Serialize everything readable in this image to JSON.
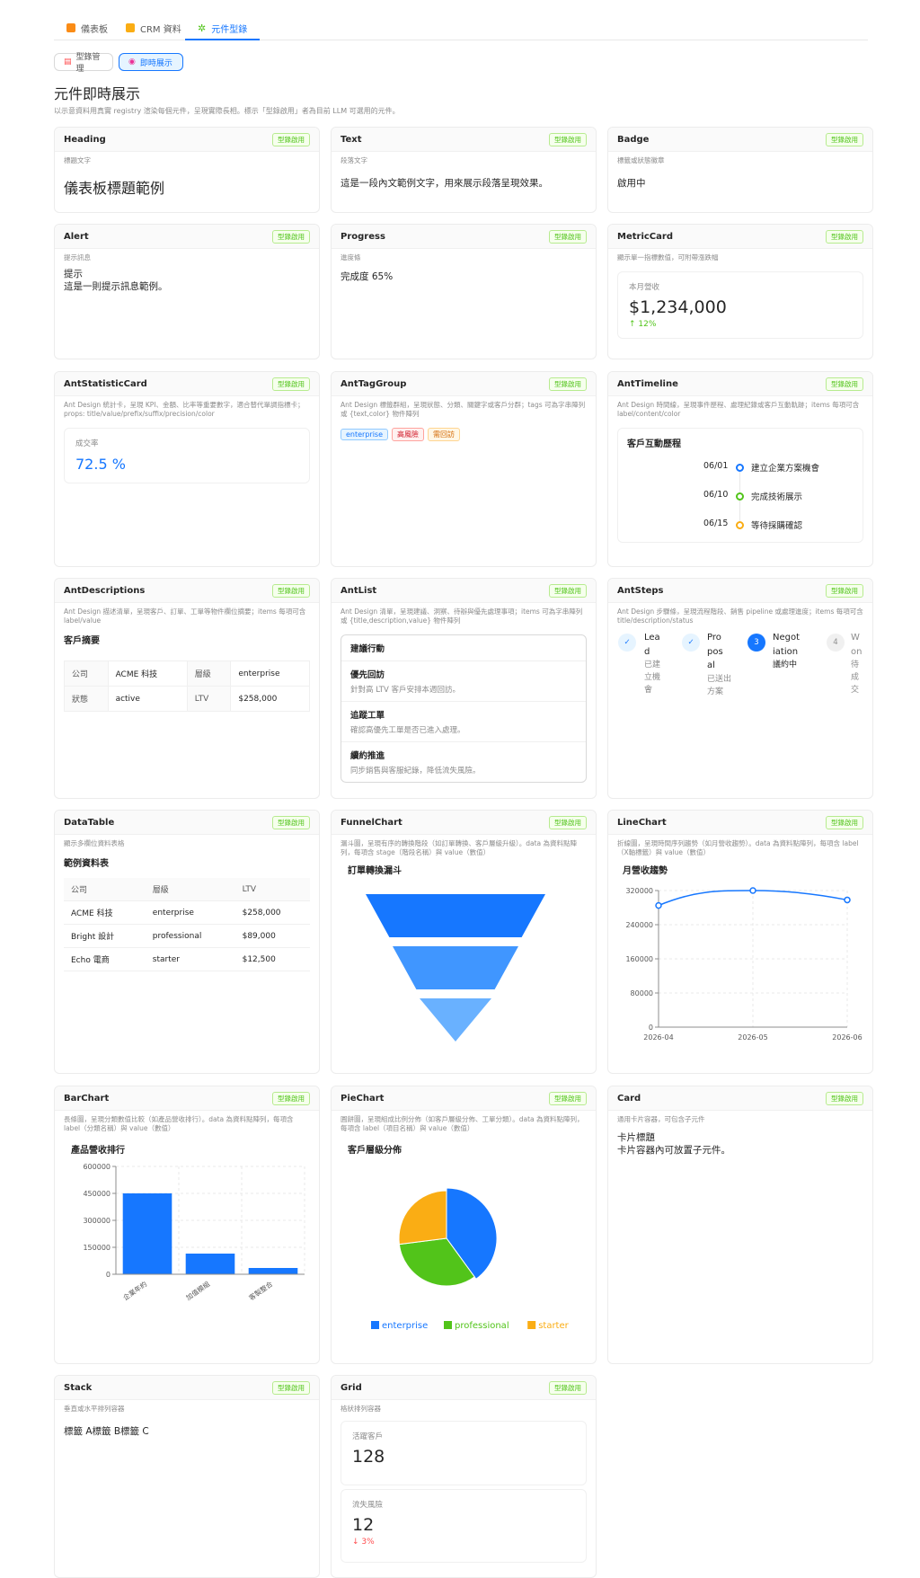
{
  "tabs": [
    {
      "label": "儀表板",
      "color": "#fa8c16"
    },
    {
      "label": "CRM 資料",
      "color": "#faad14"
    },
    {
      "label": "元件型錄",
      "color": "#52c41a"
    }
  ],
  "subtabs": [
    {
      "label": "型錄管理"
    },
    {
      "label": "即時展示"
    }
  ],
  "page": {
    "title": "元件即時展示",
    "description": "以示意資料用真實 registry 渲染每個元件，呈現實際長相。標示「型錄啟用」者為目前 LLM 可選用的元件。"
  },
  "badge_label": "型錄啟用",
  "cards": {
    "heading": {
      "name": "Heading",
      "desc": "標題文字",
      "text": "儀表板標題範例"
    },
    "text": {
      "name": "Text",
      "desc": "段落文字",
      "text": "這是一段內文範例文字，用來展示段落呈現效果。"
    },
    "badge": {
      "name": "Badge",
      "desc": "標籤或狀態徽章",
      "text": "啟用中"
    },
    "alert": {
      "name": "Alert",
      "desc": "提示訊息",
      "title": "提示",
      "text": "這是一則提示訊息範例。"
    },
    "progress": {
      "name": "Progress",
      "desc": "進度條",
      "text": "完成度 65%",
      "value": 65
    },
    "metric": {
      "name": "MetricCard",
      "desc": "顯示單一指標數值，可附帶漲跌幅",
      "title": "本月營收",
      "value": "$1,234,000",
      "trend": "↑ 12%"
    },
    "antstat": {
      "name": "AntStatisticCard",
      "desc": "Ant Design 統計卡，呈現 KPI、金額、比率等重要數字，適合替代單調指標卡；props: title/value/prefix/suffix/precision/color",
      "title": "成交率",
      "value": "72.5 %"
    },
    "anttag": {
      "name": "AntTagGroup",
      "desc": "Ant Design 標籤群組，呈現狀態、分類、關鍵字或客戶分群；tags 可為字串陣列或 {text,color} 物件陣列",
      "tags": [
        "enterprise",
        "高風險",
        "需回訪"
      ]
    },
    "timeline": {
      "name": "AntTimeline",
      "desc": "Ant Design 時間線，呈現事件歷程、處理紀錄或客戶互動軌跡；items 每項可含 label/content/color",
      "title": "客戶互動歷程",
      "items": [
        {
          "label": "06/01",
          "content": "建立企業方案機會",
          "color": "#1677ff"
        },
        {
          "label": "06/10",
          "content": "完成技術展示",
          "color": "#52c41a"
        },
        {
          "label": "06/15",
          "content": "等待採購確認",
          "color": "#faad14"
        }
      ]
    },
    "descriptions": {
      "name": "AntDescriptions",
      "desc": "Ant Design 描述清單，呈現客戶、訂單、工單等物件欄位摘要；items 每項可含 label/value",
      "title": "客戶摘要",
      "rows": [
        [
          {
            "label": "公司",
            "value": "ACME 科技"
          },
          {
            "label": "層級",
            "value": "enterprise"
          }
        ],
        [
          {
            "label": "狀態",
            "value": "active"
          },
          {
            "label": "LTV",
            "value": "$258,000"
          }
        ]
      ]
    },
    "antlist": {
      "name": "AntList",
      "desc": "Ant Design 清單，呈現建議、洞察、待辦與優先處理事項；items 可為字串陣列或 {title,description,value} 物件陣列",
      "header": "建議行動",
      "items": [
        {
          "title": "優先回訪",
          "desc": "針對高 LTV 客戶安排本週回訪。"
        },
        {
          "title": "追蹤工單",
          "desc": "確認高優先工單是否已進入處理。"
        },
        {
          "title": "續約推進",
          "desc": "同步銷售與客服紀錄，降低流失風險。"
        }
      ]
    },
    "steps": {
      "name": "AntSteps",
      "desc": "Ant Design 步驟條，呈現流程階段、銷售 pipeline 或處理進度；items 每項可含 title/description/status",
      "items": [
        {
          "title": "Lead",
          "desc": "已建立機會",
          "status": "finish",
          "lines": [
            "Lea",
            "d"
          ],
          "desc_lines": [
            "已建",
            "立機",
            "會"
          ]
        },
        {
          "title": "Proposal",
          "desc": "已送出方案",
          "status": "finish",
          "lines": [
            "Pro",
            "pos",
            "al"
          ],
          "desc_lines": [
            "已送出",
            "方案"
          ]
        },
        {
          "title": "Negotiation",
          "desc": "議約中",
          "status": "process",
          "lines": [
            "Negot",
            "iation"
          ],
          "desc_lines": [
            "議約中"
          ],
          "num": "3"
        },
        {
          "title": "Won",
          "desc": "待成交",
          "status": "wait",
          "lines": [
            "W",
            "on"
          ],
          "desc_lines": [
            "待",
            "成",
            "交"
          ],
          "num": "4"
        }
      ]
    },
    "datatable": {
      "name": "DataTable",
      "desc": "顯示多欄位資料表格",
      "title": "範例資料表",
      "columns": [
        "公司",
        "層級",
        "LTV"
      ],
      "rows": [
        [
          "ACME 科技",
          "enterprise",
          "$258,000"
        ],
        [
          "Bright 設計",
          "professional",
          "$89,000"
        ],
        [
          "Echo 電商",
          "starter",
          "$12,500"
        ]
      ]
    },
    "funnel": {
      "name": "FunnelChart",
      "desc": "漏斗圖，呈現有序的轉換階段（如訂單轉換、客戶層級升級）。data 為資料點陣列，每項含 stage（階段名稱）與 value（數值）",
      "title": "訂單轉換漏斗"
    },
    "line": {
      "name": "LineChart",
      "desc": "折線圖，呈現時間序列趨勢（如月營收趨勢）。data 為資料點陣列，每項含 label（X軸標籤）與 value（數值）",
      "title": "月營收趨勢"
    },
    "bar": {
      "name": "BarChart",
      "desc": "長條圖，呈現分類數值比較（如產品營收排行）。data 為資料點陣列，每項含 label（分類名稱）與 value（數值）",
      "title": "產品營收排行"
    },
    "pie": {
      "name": "PieChart",
      "desc": "圓餅圖，呈現組成比例分佈（如客戶層級分佈、工單分類）。data 為資料點陣列，每項含 label（項目名稱）與 value（數值）",
      "title": "客戶層級分佈"
    },
    "card": {
      "name": "Card",
      "desc": "通用卡片容器，可包含子元件",
      "title": "卡片標題",
      "text": "卡片容器內可放置子元件。"
    },
    "stack": {
      "name": "Stack",
      "desc": "垂直或水平排列容器",
      "text": "標籤 A標籤 B標籤 C"
    },
    "grid": {
      "name": "Grid",
      "desc": "格狀排列容器",
      "items": [
        {
          "title": "活躍客戶",
          "value": "128"
        },
        {
          "title": "流失風險",
          "value": "12",
          "trend": "↓ 3%"
        }
      ]
    }
  },
  "chart_data": [
    {
      "type": "funnel",
      "title": "訂單轉換漏斗",
      "values": [
        100,
        70,
        40
      ],
      "colors": [
        "#1677ff",
        "#4096ff",
        "#69b1ff"
      ]
    },
    {
      "type": "line",
      "title": "月營收趨勢",
      "x": [
        "2026-04",
        "2026-05",
        "2026-06"
      ],
      "values": [
        285000,
        320000,
        298000
      ],
      "ylim": [
        0,
        320000
      ],
      "yticks": [
        0,
        80000,
        160000,
        240000,
        320000
      ],
      "color": "#1677ff",
      "grid": true
    },
    {
      "type": "bar",
      "title": "產品營收排行",
      "categories": [
        "企業年約",
        "加值模組",
        "客製整合"
      ],
      "values": [
        450000,
        115000,
        35000
      ],
      "ylim": [
        0,
        600000
      ],
      "yticks": [
        0,
        150000,
        300000,
        450000,
        600000
      ],
      "color": "#1677ff",
      "grid": true
    },
    {
      "type": "pie",
      "title": "客戶層級分佈",
      "labels": [
        "enterprise",
        "professional",
        "starter"
      ],
      "values": [
        40,
        33,
        27
      ],
      "colors": [
        "#1677ff",
        "#52c41a",
        "#faad14"
      ],
      "legend": "bottom"
    }
  ]
}
